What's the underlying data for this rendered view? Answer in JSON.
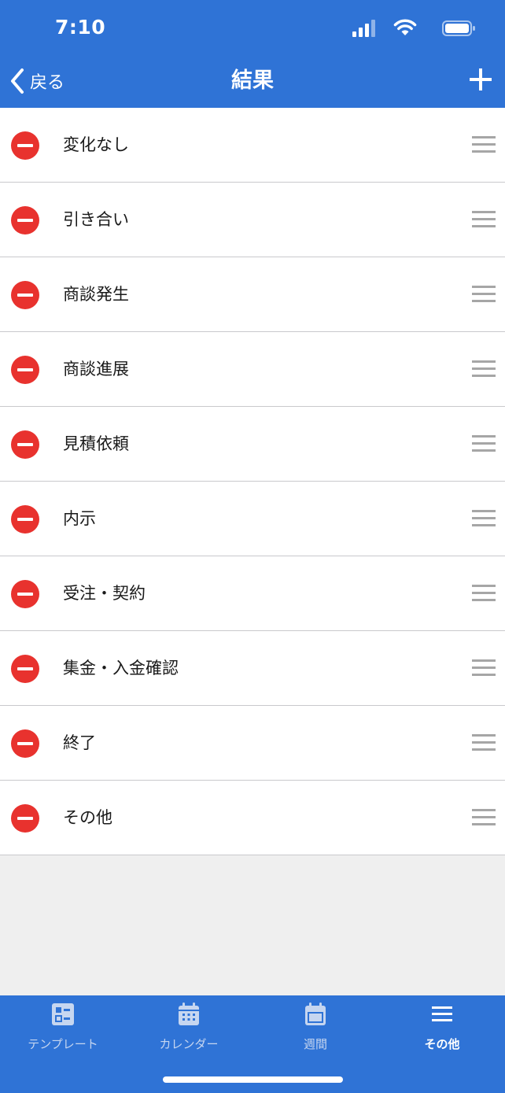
{
  "status_bar": {
    "time": "7:10"
  },
  "nav": {
    "back_label": "戻る",
    "title": "結果"
  },
  "items": [
    {
      "label": "変化なし"
    },
    {
      "label": "引き合い"
    },
    {
      "label": "商談発生"
    },
    {
      "label": "商談進展"
    },
    {
      "label": "見積依頼"
    },
    {
      "label": "内示"
    },
    {
      "label": "受注・契約"
    },
    {
      "label": "集金・入金確認"
    },
    {
      "label": "終了"
    },
    {
      "label": "その他"
    }
  ],
  "tabbar": {
    "tabs": [
      {
        "label": "テンプレート",
        "icon": "template-icon"
      },
      {
        "label": "カレンダー",
        "icon": "calendar-icon"
      },
      {
        "label": "週間",
        "icon": "week-icon"
      },
      {
        "label": "その他",
        "icon": "menu-icon",
        "active": true
      }
    ]
  },
  "colors": {
    "primary": "#2f73d6",
    "delete": "#e8322e",
    "background": "#efefef"
  }
}
